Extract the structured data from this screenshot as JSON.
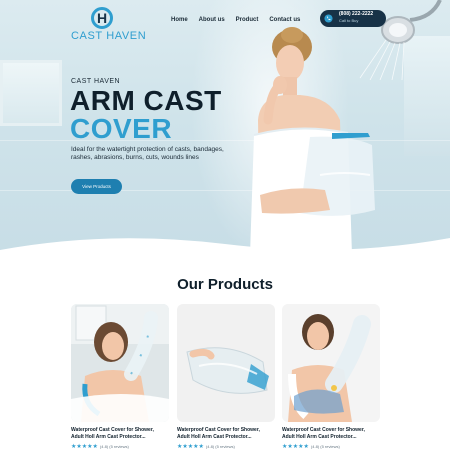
{
  "brand": {
    "logo_letter": "H",
    "name": "CAST HAVEN"
  },
  "nav": {
    "items": [
      "Home",
      "About us",
      "Product",
      "Contact us"
    ]
  },
  "contact": {
    "phone": "(808) 222-2222",
    "sub": "Call to Buy"
  },
  "hero": {
    "eyebrow": "CAST HAVEN",
    "title_line1": "ARM CAST",
    "title_line2": "COVER",
    "description": "Ideal for the watertight protection of casts, bandages, rashes, abrasions, burns, cuts, wounds lines",
    "cta_label": "View Products"
  },
  "products": {
    "heading": "Our Products",
    "items": [
      {
        "name_line1": "Waterproof Cast Cover for Shower,",
        "name_line2": "Adult Holl Arm Cast Protector...",
        "stars": "★★★★★",
        "reviews": "(4.8) (5 reviews)"
      },
      {
        "name_line1": "Waterproof Cast Cover for Shower,",
        "name_line2": "Adult Holl Arm Cast Protector...",
        "stars": "★★★★★",
        "reviews": "(4.8) (5 reviews)"
      },
      {
        "name_line1": "Waterproof Cast Cover for Shower,",
        "name_line2": "Adult Holl Arm Cast Protector...",
        "stars": "★★★★★",
        "reviews": "(4.8) (5 reviews)"
      }
    ]
  },
  "colors": {
    "accent": "#2f9ecf",
    "dark": "#173247",
    "button": "#1e7fb0"
  }
}
